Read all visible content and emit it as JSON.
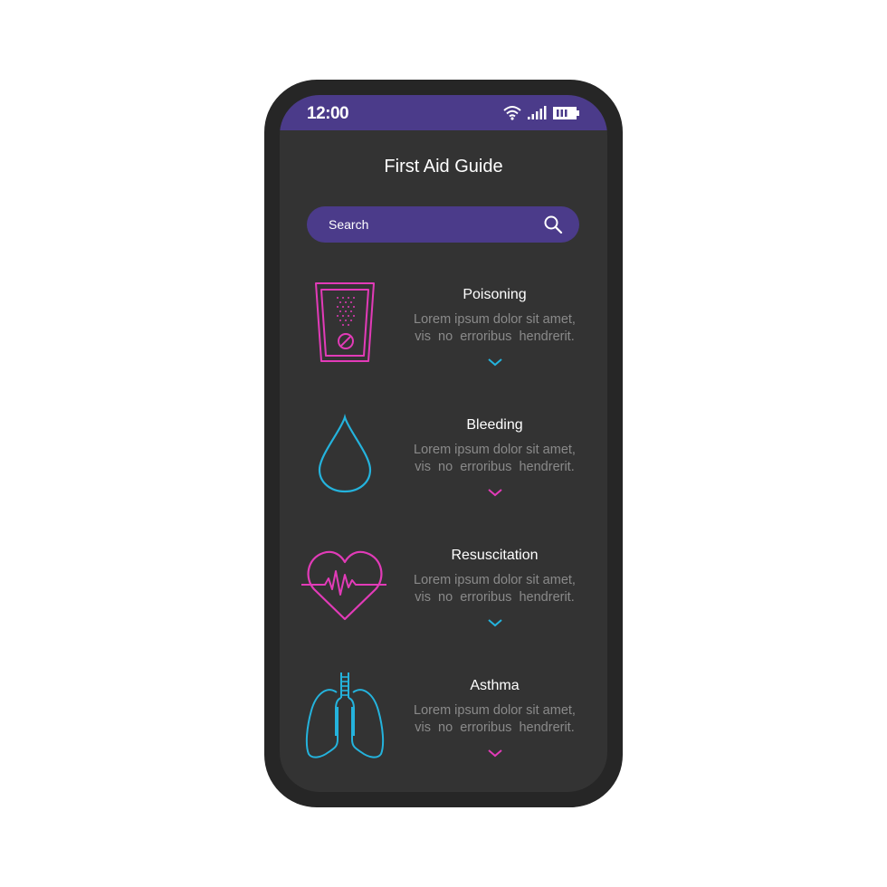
{
  "status_bar": {
    "time": "12:00",
    "icons": [
      "wifi-icon",
      "signal-icon",
      "battery-icon"
    ]
  },
  "header": {
    "title": "First Aid Guide"
  },
  "search": {
    "placeholder": "Search",
    "icon": "search-icon"
  },
  "colors": {
    "accent": "#4b3b8a",
    "pink": "#e23bb8",
    "cyan": "#24b3dd",
    "background": "#333333"
  },
  "items": [
    {
      "title": "Poisoning",
      "description_line1": "Lorem ipsum dolor sit amet,",
      "description_line2": "vis  no  erroribus  hendrerit.",
      "icon": "poison-bottle-icon",
      "chevron_color": "cyan"
    },
    {
      "title": "Bleeding",
      "description_line1": "Lorem ipsum dolor sit amet,",
      "description_line2": "vis  no  erroribus  hendrerit.",
      "icon": "blood-drop-icon",
      "chevron_color": "pink"
    },
    {
      "title": "Resuscitation",
      "description_line1": "Lorem ipsum dolor sit amet,",
      "description_line2": "vis  no  erroribus  hendrerit.",
      "icon": "heart-pulse-icon",
      "chevron_color": "cyan"
    },
    {
      "title": "Asthma",
      "description_line1": "Lorem ipsum dolor sit amet,",
      "description_line2": "vis  no  erroribus  hendrerit.",
      "icon": "lungs-icon",
      "chevron_color": "pink"
    }
  ]
}
